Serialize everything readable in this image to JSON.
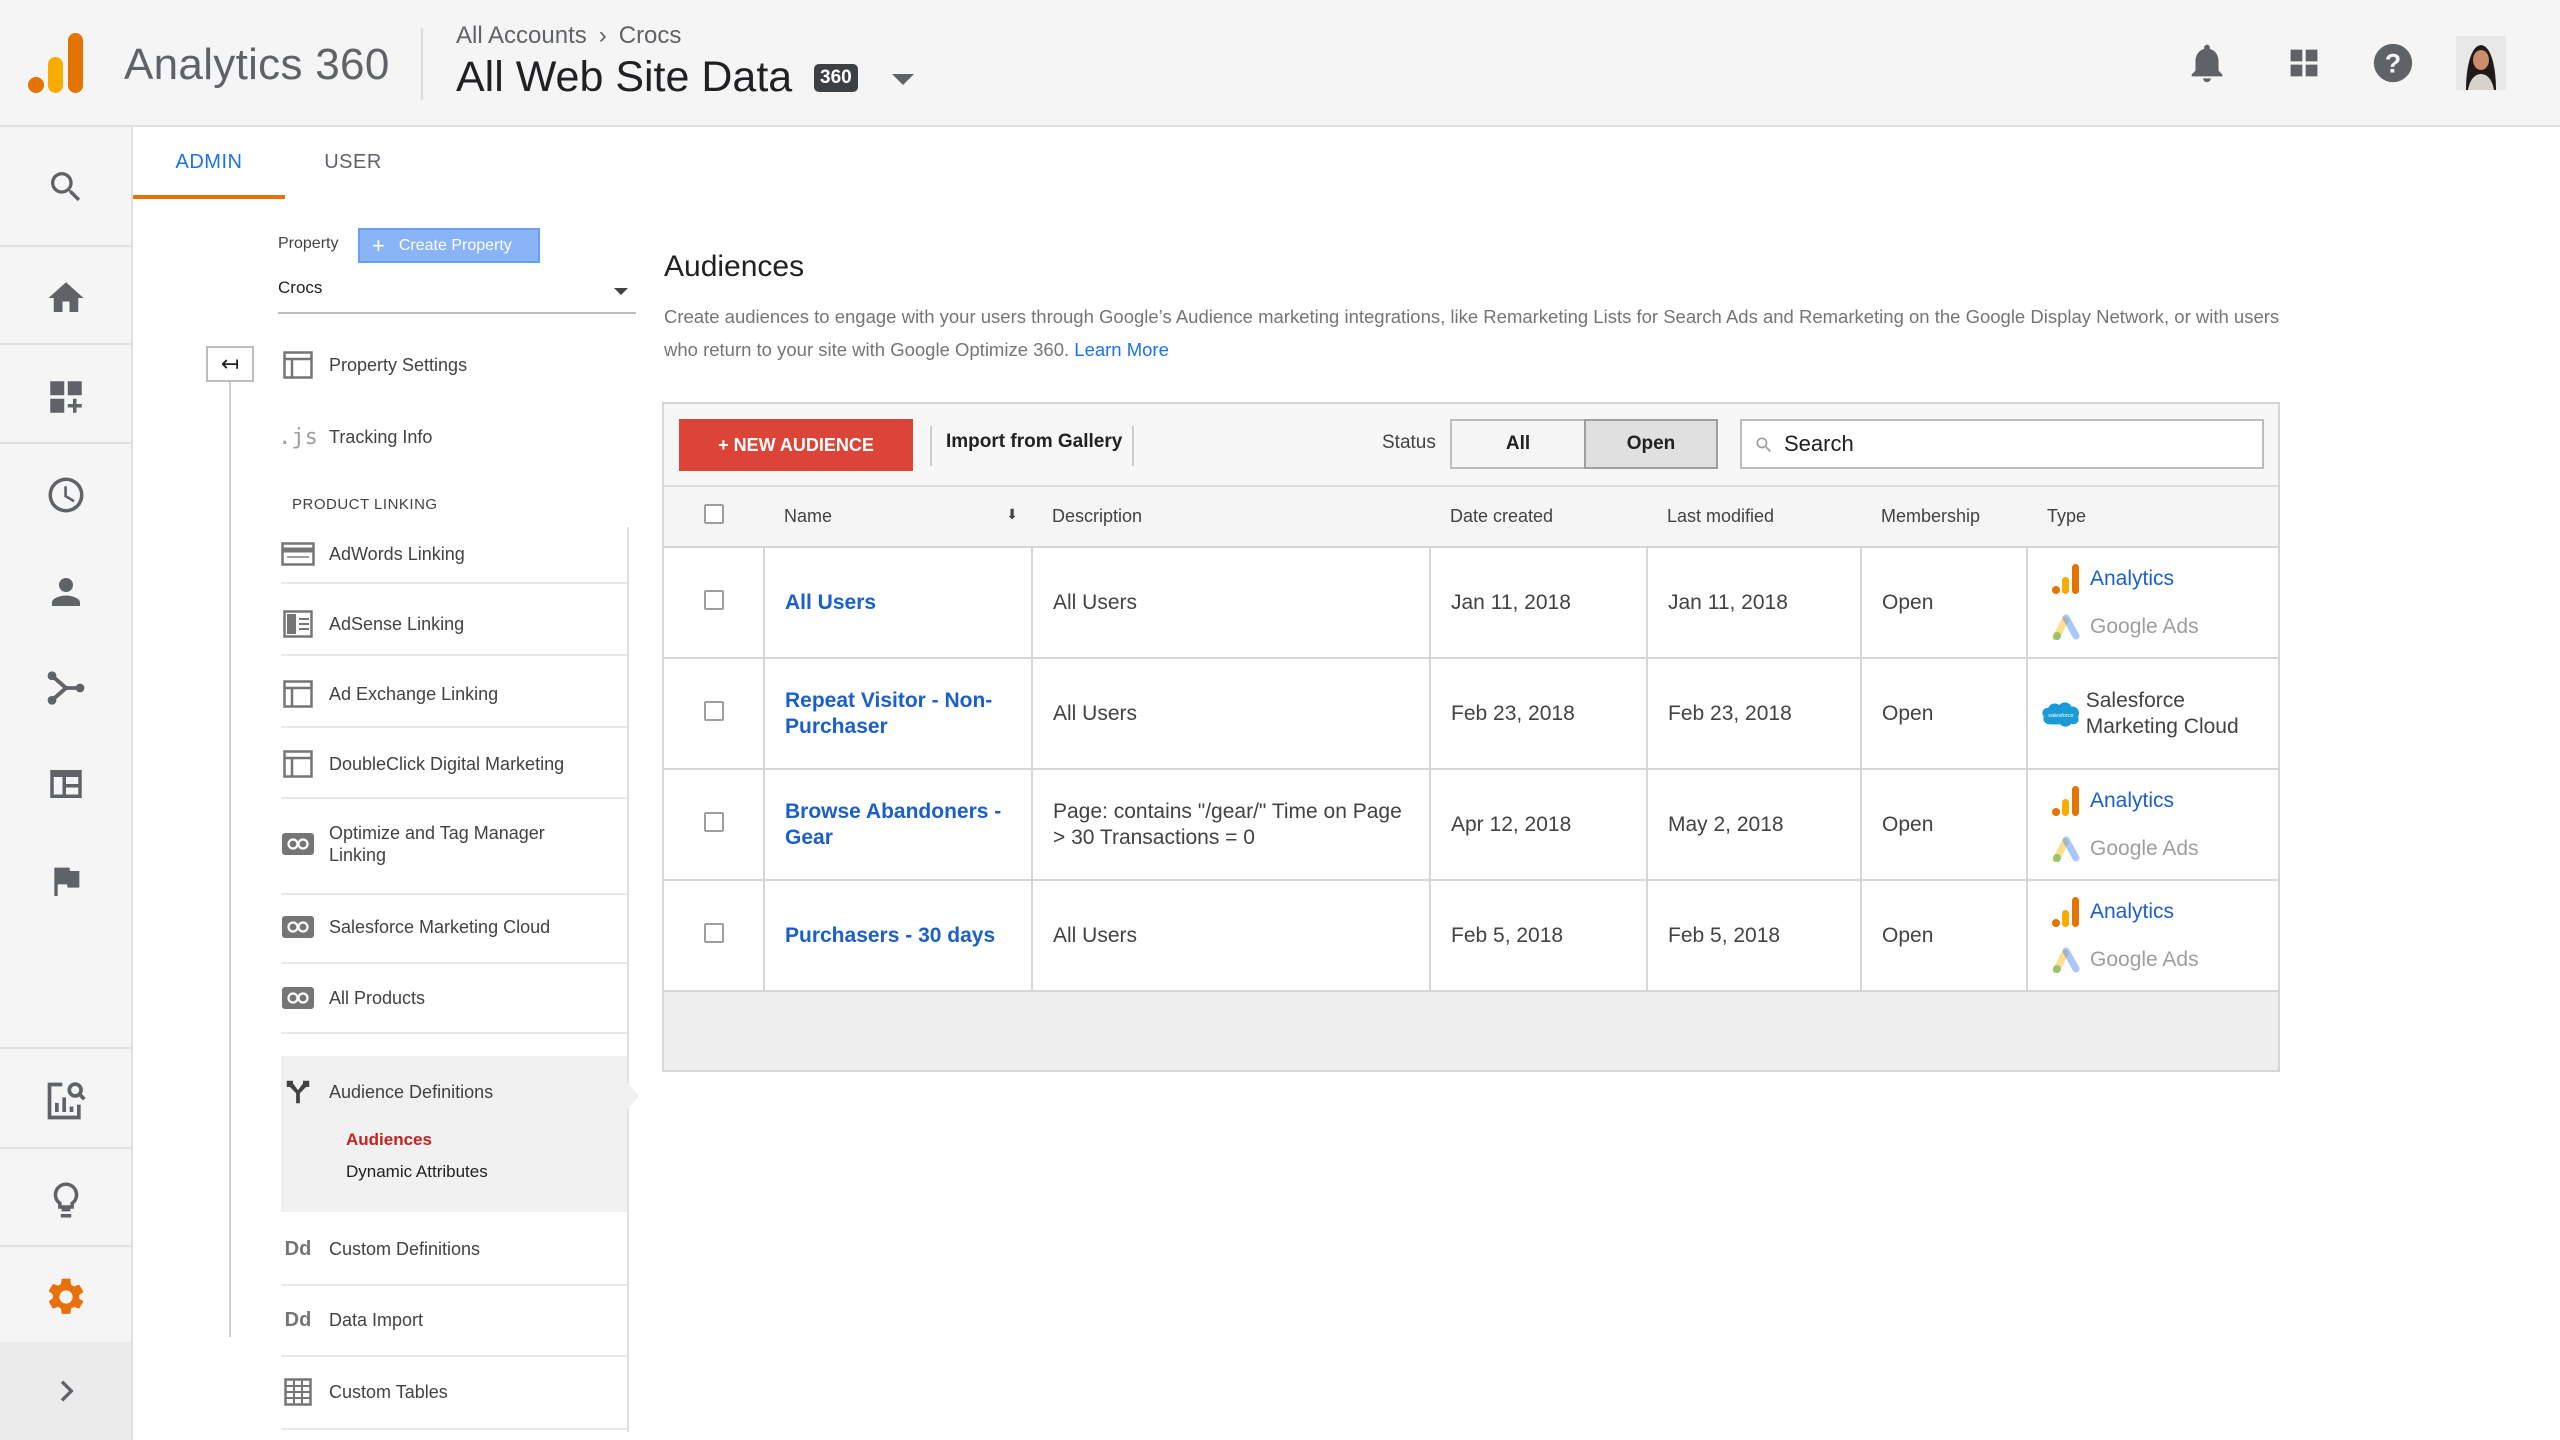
{
  "header": {
    "app_name": "Analytics 360",
    "breadcrumb": {
      "account": "All Accounts",
      "separator": "›",
      "property": "Crocs"
    },
    "view_name": "All Web Site Data",
    "view_badge": "360",
    "icons": [
      "bell-icon",
      "apps-icon",
      "help-icon",
      "avatar"
    ]
  },
  "tabs": {
    "admin": "ADMIN",
    "user": "USER"
  },
  "property_panel": {
    "label": "Property",
    "create_button": "Create Property",
    "selected": "Crocs",
    "items": [
      {
        "label": "Property Settings",
        "icon": "window-icon"
      },
      {
        "label": "Tracking Info",
        "icon": "js-icon"
      }
    ],
    "product_linking_heading": "PRODUCT LINKING",
    "linking_items": [
      "AdWords Linking",
      "AdSense Linking",
      "Ad Exchange Linking",
      "DoubleClick Digital Marketing",
      "Optimize and Tag Manager Linking",
      "Salesforce Marketing Cloud",
      "All Products"
    ],
    "audience_definitions": {
      "label": "Audience Definitions",
      "sub_items": [
        "Audiences",
        "Dynamic Attributes"
      ],
      "active": "Audiences"
    },
    "bottom_items": [
      "Custom Definitions",
      "Data Import",
      "Custom Tables"
    ]
  },
  "main": {
    "title": "Audiences",
    "description": "Create audiences to engage with your users through Google’s Audience marketing integrations, like Remarketing Lists for Search Ads and Remarketing on the Google Display Network, or with users who return to your site with Google Optimize 360.",
    "learn_more": "Learn More",
    "toolbar": {
      "new_audience": "+ NEW AUDIENCE",
      "import": "Import from Gallery",
      "status_label": "Status",
      "status_options": [
        "All",
        "Open"
      ],
      "status_selected": "Open",
      "search_placeholder": "Search"
    },
    "columns": [
      "Name",
      "Description",
      "Date created",
      "Last modified",
      "Membership",
      "Type"
    ],
    "rows": [
      {
        "name": "All Users",
        "description": "All Users",
        "created": "Jan 11, 2018",
        "modified": "Jan 11, 2018",
        "membership": "Open",
        "types": [
          "Analytics",
          "Google Ads"
        ]
      },
      {
        "name": "Repeat Visitor - Non-Purchaser",
        "description": "All Users",
        "created": "Feb 23, 2018",
        "modified": "Feb 23, 2018",
        "membership": "Open",
        "types": [
          "Salesforce Marketing Cloud"
        ]
      },
      {
        "name": "Browse Abandoners - Gear",
        "description": "Page: contains \"/gear/\" Time on Page > 30 Transactions = 0",
        "created": "Apr 12, 2018",
        "modified": "May 2, 2018",
        "membership": "Open",
        "types": [
          "Analytics",
          "Google Ads"
        ]
      },
      {
        "name": "Purchasers - 30 days",
        "description": "All Users",
        "created": "Feb 5, 2018",
        "modified": "Feb 5, 2018",
        "membership": "Open",
        "types": [
          "Analytics",
          "Google Ads"
        ]
      }
    ],
    "salesforce_logo_text": "salesforce"
  },
  "colors": {
    "accent_orange": "#e8710a",
    "link_blue": "#1a5fcc",
    "new_button_red": "#db4437",
    "active_red": "#c5221f"
  }
}
